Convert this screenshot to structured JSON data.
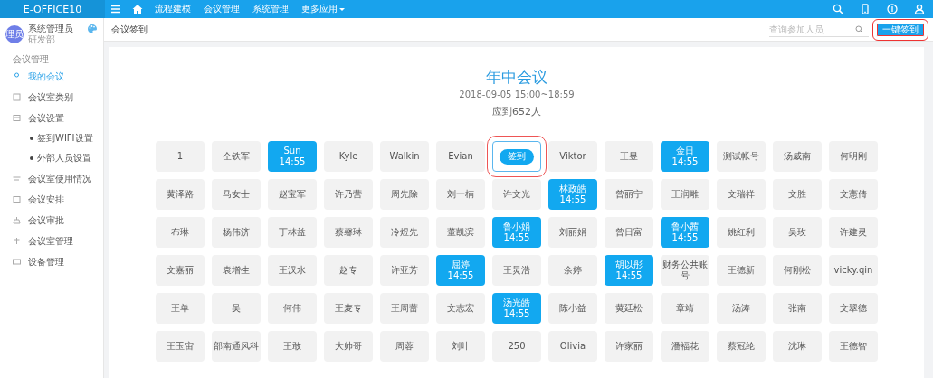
{
  "top_bar": {
    "logo": "E-OFFICE10",
    "nav": [
      "流程建模",
      "会议管理",
      "系统管理",
      "更多应用"
    ]
  },
  "user": {
    "avatar": "理员",
    "name": "系统管理员",
    "department": "研发部"
  },
  "sidebar": {
    "section": "会议管理",
    "items": [
      {
        "label": "我的会议",
        "selected": true
      },
      {
        "label": "会议室类别",
        "selected": false
      },
      {
        "label": "会议设置",
        "selected": false,
        "children": [
          {
            "label": "签到WIFI设置",
            "selected": false
          },
          {
            "label": "外部人员设置",
            "selected": false
          }
        ]
      },
      {
        "label": "会议室使用情况",
        "selected": false
      },
      {
        "label": "会议安排",
        "selected": false
      },
      {
        "label": "会议审批",
        "selected": false
      },
      {
        "label": "会议室管理",
        "selected": false
      },
      {
        "label": "设备管理",
        "selected": false
      }
    ]
  },
  "breadcrumb": "会议签到",
  "search": {
    "placeholder": "查询参加人员"
  },
  "sign_all_button": {
    "label": "一键签到",
    "highlighted": true
  },
  "meeting": {
    "title": "年中会议",
    "time": "2018-09-05 15:00~18:59",
    "expected": "应到652人"
  },
  "seats": [
    [
      {
        "kind": "seat",
        "name": "1",
        "signed": false
      },
      {
        "kind": "seat",
        "name": "仝铁军",
        "signed": false
      },
      {
        "kind": "seat",
        "name": "Sun",
        "time": "14:55",
        "signed": true
      },
      {
        "kind": "seat",
        "name": "Kyle",
        "signed": false
      },
      {
        "kind": "seat",
        "name": "Walkin",
        "signed": false
      },
      {
        "kind": "seat",
        "name": "Evian",
        "signed": false
      },
      {
        "kind": "sign",
        "name": "签到",
        "highlighted": true
      },
      {
        "kind": "seat",
        "name": "Viktor",
        "signed": false
      },
      {
        "kind": "seat",
        "name": "王昱",
        "signed": false
      },
      {
        "kind": "seat",
        "name": "金日",
        "time": "14:55",
        "signed": true
      },
      {
        "kind": "seat",
        "name": "测试帐号",
        "signed": false
      },
      {
        "kind": "seat",
        "name": "汤威南",
        "signed": false
      },
      {
        "kind": "seat",
        "name": "何明刚",
        "signed": false
      }
    ],
    [
      {
        "kind": "seat",
        "name": "黄泽路",
        "signed": false
      },
      {
        "kind": "seat",
        "name": "马女士",
        "signed": false
      },
      {
        "kind": "seat",
        "name": "赵宝军",
        "signed": false
      },
      {
        "kind": "seat",
        "name": "许乃营",
        "signed": false
      },
      {
        "kind": "seat",
        "name": "周先除",
        "signed": false
      },
      {
        "kind": "seat",
        "name": "刘一楠",
        "signed": false
      },
      {
        "kind": "seat",
        "name": "许文光",
        "signed": false
      },
      {
        "kind": "seat",
        "name": "林政皓",
        "time": "14:55",
        "signed": true
      },
      {
        "kind": "seat",
        "name": "曾丽宁",
        "signed": false
      },
      {
        "kind": "seat",
        "name": "王润雕",
        "signed": false
      },
      {
        "kind": "seat",
        "name": "文瑞祥",
        "signed": false
      },
      {
        "kind": "seat",
        "name": "文胜",
        "signed": false
      },
      {
        "kind": "seat",
        "name": "文憲倩",
        "signed": false
      }
    ],
    [
      {
        "kind": "seat",
        "name": "布琳",
        "signed": false
      },
      {
        "kind": "seat",
        "name": "杨伟济",
        "signed": false
      },
      {
        "kind": "seat",
        "name": "丁林益",
        "signed": false
      },
      {
        "kind": "seat",
        "name": "蔡馨琳",
        "signed": false
      },
      {
        "kind": "seat",
        "name": "冷煜先",
        "signed": false
      },
      {
        "kind": "seat",
        "name": "董凯滨",
        "signed": false
      },
      {
        "kind": "seat",
        "name": "鲁小娟",
        "time": "14:55",
        "signed": true
      },
      {
        "kind": "seat",
        "name": "刘丽娟",
        "signed": false
      },
      {
        "kind": "seat",
        "name": "曾日富",
        "signed": false
      },
      {
        "kind": "seat",
        "name": "鲁小茜",
        "time": "14:55",
        "signed": true
      },
      {
        "kind": "seat",
        "name": "姚红利",
        "signed": false
      },
      {
        "kind": "seat",
        "name": "吴玫",
        "signed": false
      },
      {
        "kind": "seat",
        "name": "许建灵",
        "signed": false
      }
    ],
    [
      {
        "kind": "seat",
        "name": "文嘉丽",
        "signed": false
      },
      {
        "kind": "seat",
        "name": "袁增生",
        "signed": false
      },
      {
        "kind": "seat",
        "name": "王汉水",
        "signed": false
      },
      {
        "kind": "seat",
        "name": "赵专",
        "signed": false
      },
      {
        "kind": "seat",
        "name": "许亚芳",
        "signed": false
      },
      {
        "kind": "seat",
        "name": "屈婷",
        "time": "14:55",
        "signed": true
      },
      {
        "kind": "seat",
        "name": "王炅浩",
        "signed": false
      },
      {
        "kind": "seat",
        "name": "余婷",
        "signed": false
      },
      {
        "kind": "seat",
        "name": "胡以彤",
        "time": "14:55",
        "signed": true
      },
      {
        "kind": "seat",
        "name": "财务公共账号",
        "signed": false
      },
      {
        "kind": "seat",
        "name": "王德新",
        "signed": false
      },
      {
        "kind": "seat",
        "name": "何刚松",
        "signed": false
      },
      {
        "kind": "seat",
        "name": "vicky.qin",
        "signed": false
      }
    ],
    [
      {
        "kind": "seat",
        "name": "王单",
        "signed": false
      },
      {
        "kind": "seat",
        "name": "吴",
        "signed": false
      },
      {
        "kind": "seat",
        "name": "何伟",
        "signed": false
      },
      {
        "kind": "seat",
        "name": "王麦专",
        "signed": false
      },
      {
        "kind": "seat",
        "name": "王周蕾",
        "signed": false
      },
      {
        "kind": "seat",
        "name": "文志宏",
        "signed": false
      },
      {
        "kind": "seat",
        "name": "汤光皓",
        "time": "14:55",
        "signed": true
      },
      {
        "kind": "seat",
        "name": "陈小益",
        "signed": false
      },
      {
        "kind": "seat",
        "name": "黄廷松",
        "signed": false
      },
      {
        "kind": "seat",
        "name": "章靖",
        "signed": false
      },
      {
        "kind": "seat",
        "name": "汤涛",
        "signed": false
      },
      {
        "kind": "seat",
        "name": "张南",
        "signed": false
      },
      {
        "kind": "seat",
        "name": "文翠德",
        "signed": false
      }
    ],
    [
      {
        "kind": "seat",
        "name": "王玉宙",
        "signed": false
      },
      {
        "kind": "seat",
        "name": "部南通风科",
        "signed": false
      },
      {
        "kind": "seat",
        "name": "王敢",
        "signed": false
      },
      {
        "kind": "seat",
        "name": "大帅哥",
        "signed": false
      },
      {
        "kind": "seat",
        "name": "周蓉",
        "signed": false
      },
      {
        "kind": "seat",
        "name": "刘叶",
        "signed": false
      },
      {
        "kind": "seat",
        "name": "250",
        "signed": false
      },
      {
        "kind": "seat",
        "name": "Olivia",
        "signed": false
      },
      {
        "kind": "seat",
        "name": "许家丽",
        "signed": false
      },
      {
        "kind": "seat",
        "name": "潘福花",
        "signed": false
      },
      {
        "kind": "seat",
        "name": "蔡冠纶",
        "signed": false
      },
      {
        "kind": "seat",
        "name": "沈琳",
        "signed": false
      },
      {
        "kind": "seat",
        "name": "王德智",
        "signed": false
      }
    ]
  ]
}
